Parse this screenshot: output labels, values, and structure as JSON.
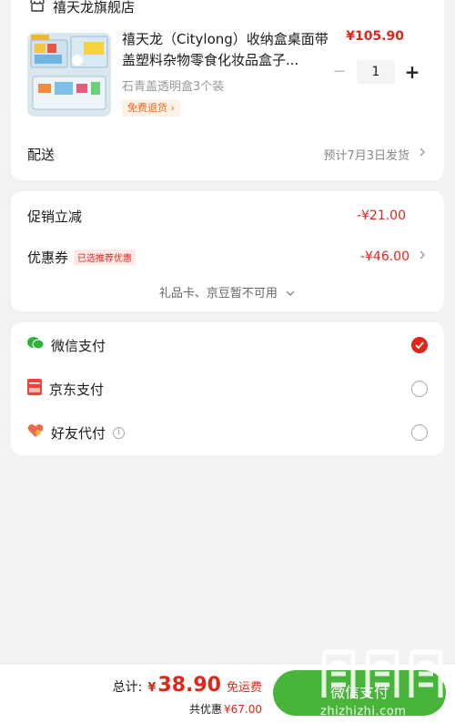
{
  "store": {
    "name": "禧天龙旗舰店",
    "product": {
      "title": "禧天龙（Citylong）收纳盒桌面带盖塑料杂物零食化妆品盒子...",
      "price": "¥105.90",
      "quantity": "1",
      "variant": "石青盖透明盒3个装",
      "badge": "免费退货",
      "badge_arrow": "›"
    },
    "shipping": {
      "label": "配送",
      "value": "预计7月3日发货"
    }
  },
  "discounts": {
    "promo": {
      "label": "促销立减",
      "value": "-¥21.00"
    },
    "coupon": {
      "label": "优惠券",
      "tag": "已选推荐优惠",
      "value": "-¥46.00"
    },
    "note": "礼品卡、京豆暂不可用"
  },
  "payment": {
    "methods": [
      {
        "label": "微信支付",
        "selected": true
      },
      {
        "label": "京东支付",
        "selected": false
      },
      {
        "label": "好友代付",
        "selected": false
      }
    ]
  },
  "bottom": {
    "total_label": "总计:",
    "total_yen": "¥",
    "total_amount": "38.90",
    "free_shipping": "免运费",
    "saving_label": "共优惠",
    "saving_amount": "¥67.00",
    "pay_button": "微信支付"
  },
  "watermark": {
    "text": "zhizhizhi.com"
  },
  "colors": {
    "accent": "#e1251b",
    "wechat_green": "#49b43a"
  }
}
